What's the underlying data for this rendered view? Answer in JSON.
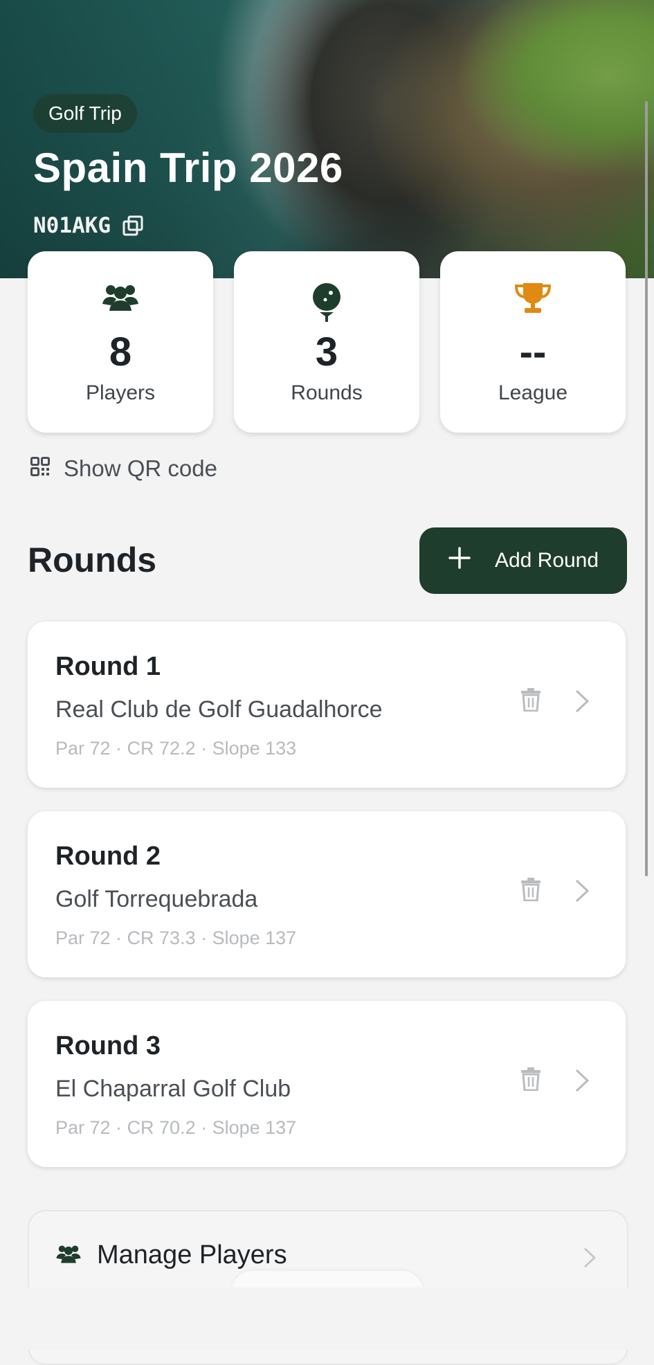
{
  "header": {
    "badge": "Golf Trip",
    "title": "Spain Trip 2026",
    "code": "N01AKG"
  },
  "stats": [
    {
      "icon": "players-icon",
      "value": "8",
      "label": "Players"
    },
    {
      "icon": "golf-ball-tee-icon",
      "value": "3",
      "label": "Rounds"
    },
    {
      "icon": "trophy-icon",
      "value": "--",
      "label": "League"
    }
  ],
  "qr": {
    "label": "Show QR code"
  },
  "rounds_section": {
    "title": "Rounds",
    "add_label": "Add Round"
  },
  "rounds": [
    {
      "title": "Round 1",
      "course": "Real Club de Golf Guadalhorce",
      "meta": "Par 72 · CR 72.2 · Slope 133"
    },
    {
      "title": "Round 2",
      "course": "Golf Torrequebrada",
      "meta": "Par 72 · CR 73.3 · Slope 137"
    },
    {
      "title": "Round 3",
      "course": "El Chaparral Golf Club",
      "meta": "Par 72 · CR 70.2 · Slope 137"
    }
  ],
  "manage": {
    "label": "Manage Players"
  },
  "colors": {
    "accent": "#1f3d2c",
    "trophy": "#e08a12",
    "card_bg": "#ffffff",
    "page_bg": "#f3f3f3"
  }
}
